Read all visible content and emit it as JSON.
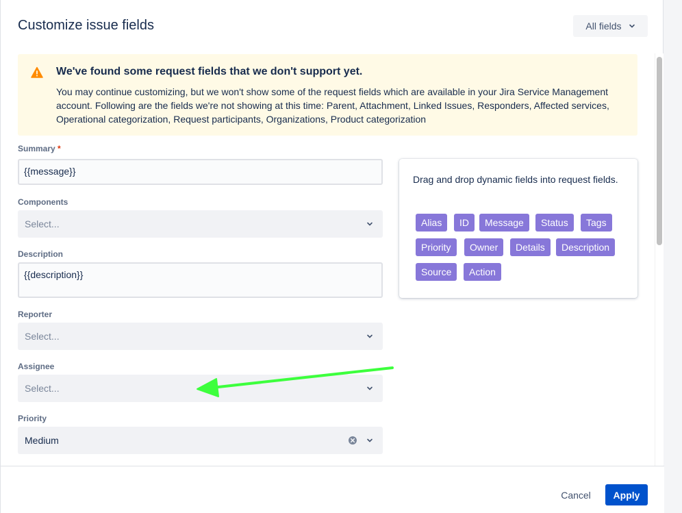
{
  "modal": {
    "title": "Customize issue fields",
    "filter_label": "All fields"
  },
  "warning": {
    "title": "We've found some request fields that we don't support yet.",
    "body": "You may continue customizing, but we won't show some of the request fields which are available in your Jira Service Management account. Following are the fields we're not showing at this time: Parent, Attachment, Linked Issues, Responders, Affected services, Operational categorization, Request participants, Organizations, Product categorization",
    "icon": "warning-triangle-icon"
  },
  "fields": {
    "summary": {
      "label": "Summary",
      "required_mark": "*",
      "value": "{{message}}"
    },
    "components": {
      "label": "Components",
      "placeholder": "Select..."
    },
    "description": {
      "label": "Description",
      "value": "{{description}}"
    },
    "reporter": {
      "label": "Reporter",
      "placeholder": "Select..."
    },
    "assignee": {
      "label": "Assignee",
      "placeholder": "Select..."
    },
    "priority": {
      "label": "Priority",
      "value": "Medium"
    }
  },
  "dynamic_panel": {
    "instruction": "Drag and drop dynamic fields into request fields.",
    "tags": [
      "Alias",
      "ID",
      "Message",
      "Status",
      "Tags",
      "Priority",
      "Owner",
      "Details",
      "Description",
      "Source",
      "Action"
    ]
  },
  "footer": {
    "cancel_label": "Cancel",
    "apply_label": "Apply"
  },
  "colors": {
    "tag_bg": "#8777d9",
    "primary_button": "#0052cc",
    "warning_bg": "#fffae6",
    "warning_icon": "#ff8b00",
    "annotation_arrow": "#3dff3d"
  }
}
